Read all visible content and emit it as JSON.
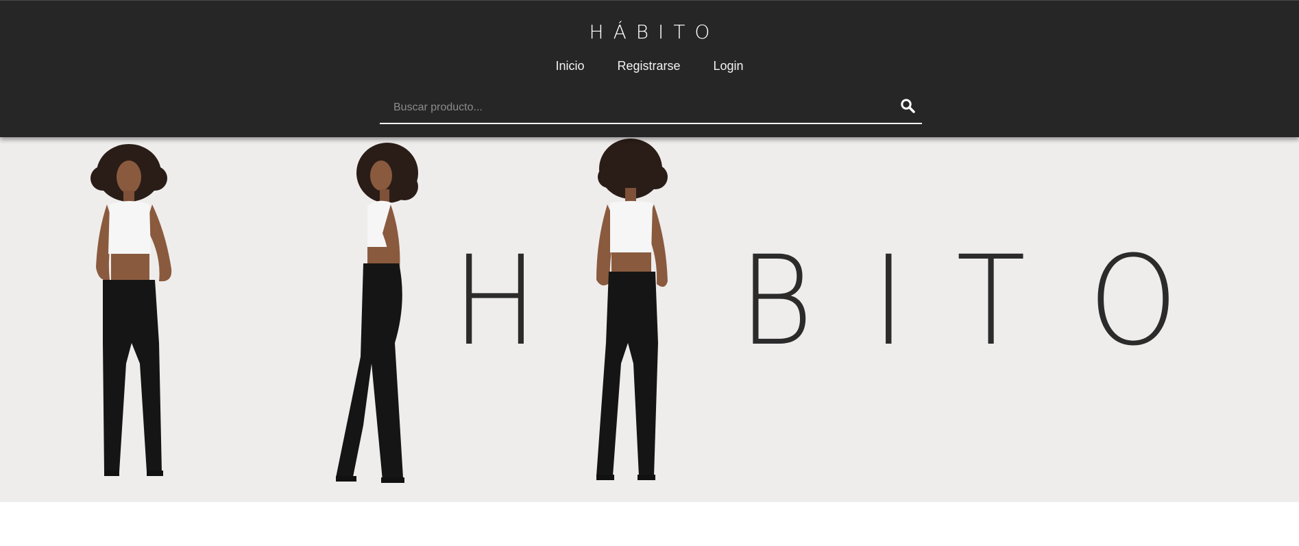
{
  "header": {
    "brand": "HÁBITO",
    "nav": [
      {
        "label": "Inicio"
      },
      {
        "label": "Registrarse"
      },
      {
        "label": "Login"
      }
    ],
    "search": {
      "placeholder": "Buscar producto...",
      "value": "",
      "icon": "search-icon"
    }
  },
  "hero": {
    "banner_text": [
      "H",
      "B",
      "I",
      "T",
      "O"
    ],
    "image": "three fashion models in white crop tops and black flared trousers",
    "colors": {
      "background": "#efedec",
      "text": "#2b2b2b"
    }
  },
  "colors": {
    "header_bg": "#262626",
    "header_text": "#ffffff"
  }
}
